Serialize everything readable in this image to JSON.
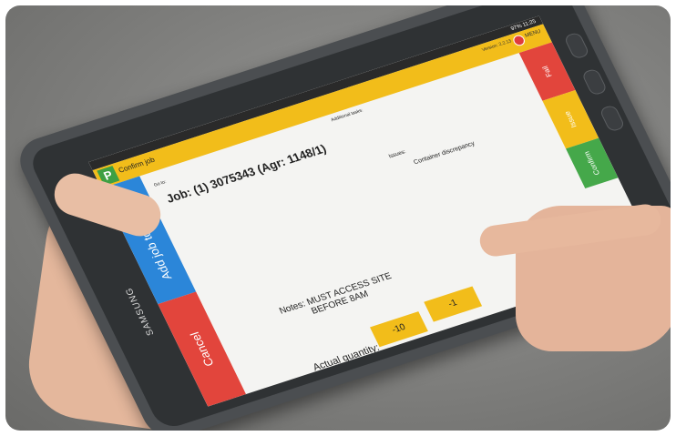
{
  "device": {
    "brand": "SAMSUNG"
  },
  "statusbar": {
    "time": "11:25",
    "battery": "97%"
  },
  "app": {
    "title": "Confirm job",
    "version": "Version: 2.2.13",
    "menu": "MENU",
    "logo_letter": "P"
  },
  "job": {
    "goto_label": "Go to:",
    "job_line": "Job: (1) 3075343 (Agr: 1148/1)",
    "additional_tasks_label": "Additional tasks:",
    "issues_label": "Issues:",
    "issue_value": "Container discrepancy",
    "notes": "Notes: MUST ACCESS SITE BEFORE 8AM",
    "quantity_label": "Actual quantity:",
    "quantity_buttons": [
      "-10",
      "-1"
    ]
  },
  "buttons": {
    "add_job_to_group": "Add job to group",
    "cancel": "Cancel",
    "fail": "Fail",
    "middle": "Issue",
    "green": "Confirm"
  },
  "colors": {
    "yellow": "#f2bd1a",
    "blue": "#2b86d9",
    "red": "#e2453c",
    "green": "#45a84a"
  }
}
